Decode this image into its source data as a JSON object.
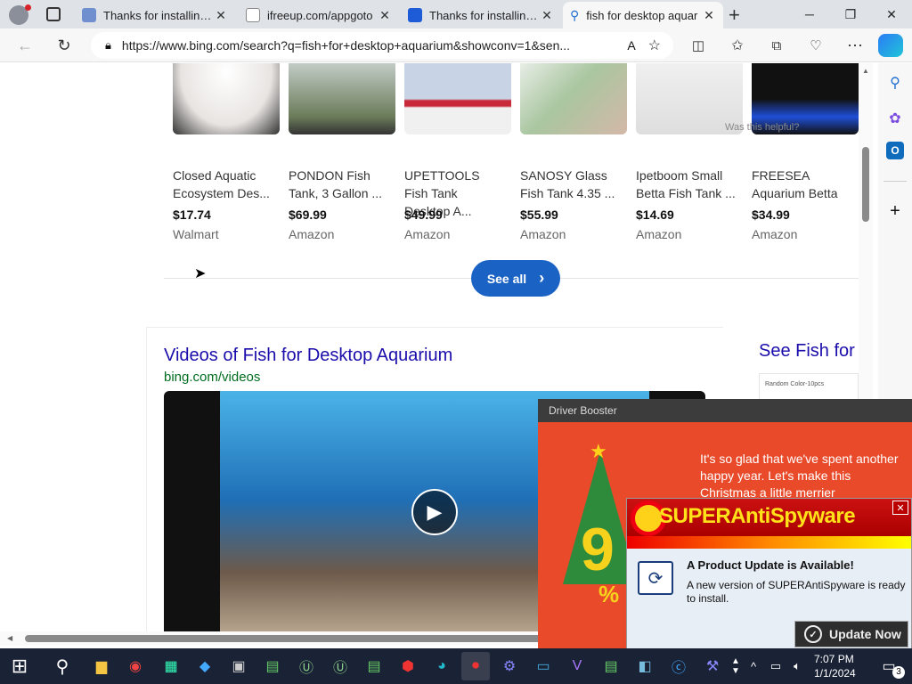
{
  "browser": {
    "tabs": [
      {
        "title": "Thanks for installing D",
        "favicon_color": "#6f8fcf",
        "active": false
      },
      {
        "title": "ifreeup.com/appgoto",
        "favicon_color": "#888888",
        "active": false
      },
      {
        "title": "Thanks for installing D",
        "favicon_color": "#1e5bd6",
        "active": false
      },
      {
        "title": "fish for desktop aquar",
        "favicon_color": "#1f6fd1",
        "active": true
      }
    ],
    "url": "https://www.bing.com/search?q=fish+for+desktop+aquarium&showconv=1&sen...",
    "new_tab_icon": "plus-icon"
  },
  "shopping": {
    "products": [
      {
        "name": "Closed Aquatic Ecosystem Des...",
        "price": "$17.74",
        "store": "Walmart",
        "img_color": "#e8e4e2"
      },
      {
        "name": "PONDON Fish Tank, 3 Gallon ...",
        "price": "$69.99",
        "store": "Amazon",
        "img_color": "#6b7c5a"
      },
      {
        "name": "UPETTOOLS Fish Tank Desktop A...",
        "price": "$49.99",
        "store": "Amazon",
        "img_color": "#c8d4e6"
      },
      {
        "name": "SANOSY Glass Fish Tank 4.35 ...",
        "price": "$55.99",
        "store": "Amazon",
        "img_color": "#a9c6a0"
      },
      {
        "name": "Ipetboom Small Betta Fish Tank ...",
        "price": "$14.69",
        "store": "Amazon",
        "img_color": "#ececec"
      },
      {
        "name": "FREESEA Aquarium Betta ...",
        "price": "$34.99",
        "store": "Amazon",
        "img_color": "#1a1a2e"
      }
    ],
    "was_this_helpful": "Was this helpful?",
    "see_all": "See all"
  },
  "videos": {
    "title": "Videos of Fish for Desktop Aquarium",
    "source": "bing.com/videos"
  },
  "side_panel": {
    "title": "See Fish for l",
    "thumb_caption": "Random Color-10pcs"
  },
  "driver_booster": {
    "window_title": "Driver Booster",
    "promo_text": "It's so glad that we've spent another happy year. Let's make this Christmas a little merrier",
    "promo_digit": "9",
    "promo_percent": "%"
  },
  "superantispyware": {
    "brand": "SUPERAntiSpyware",
    "heading": "A Product Update is Available!",
    "message": "A new version of SUPERAntiSpyware is ready to install.",
    "button": "Update Now"
  },
  "taskbar": {
    "time": "7:07 PM",
    "date": "1/1/2024",
    "notification_count": "3"
  }
}
